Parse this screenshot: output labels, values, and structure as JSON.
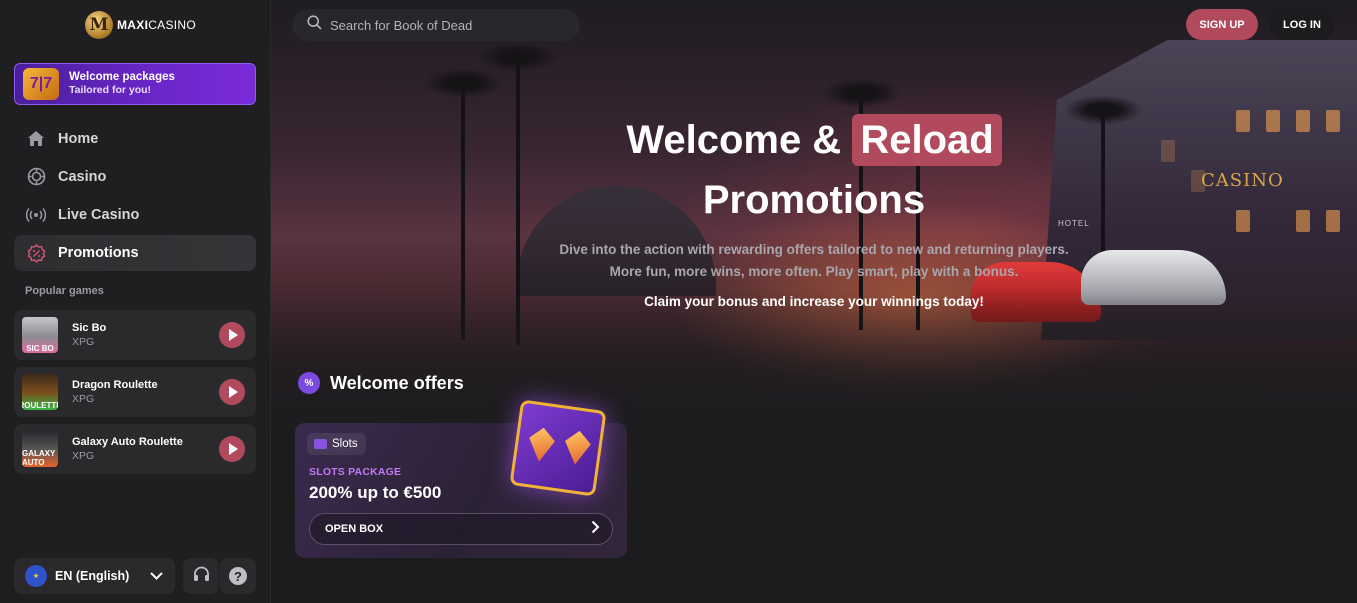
{
  "brand": {
    "logo_letter": "M",
    "name_bold": "MAXI",
    "name_light": "CASINO"
  },
  "welcome_pack": {
    "title": "Welcome packages",
    "subtitle": "Tailored for you!",
    "icon_text": "7|7"
  },
  "nav": {
    "items": [
      {
        "label": "Home",
        "icon": "home-icon"
      },
      {
        "label": "Casino",
        "icon": "casino-chip-icon"
      },
      {
        "label": "Live Casino",
        "icon": "live-broadcast-icon"
      },
      {
        "label": "Promotions",
        "icon": "promotions-percent-icon",
        "active": true
      }
    ]
  },
  "popular": {
    "title": "Popular games",
    "games": [
      {
        "name": "Sic Bo",
        "provider": "XPG",
        "thumb_text": "SIC BO"
      },
      {
        "name": "Dragon Roulette",
        "provider": "XPG",
        "thumb_text": "ROULETTE"
      },
      {
        "name": "Galaxy Auto Roulette",
        "provider": "XPG",
        "thumb_text": "GALAXY AUTO"
      }
    ]
  },
  "footer": {
    "language": "EN (English)"
  },
  "header": {
    "search_placeholder": "Search for Book of Dead",
    "signup_label": "SIGN UP",
    "login_label": "LOG IN"
  },
  "hero": {
    "title_part1": "Welcome &",
    "title_highlight": "Reload",
    "title_line2": "Promotions",
    "desc_line1": "Dive into the action with rewarding offers tailored to new and returning players.",
    "desc_line2": "More fun, more wins, more often. Play smart, play with a bonus.",
    "cta": "Claim your bonus and increase your winnings today!",
    "casino_sign": "CASINO",
    "hotel_sign": "HOTEL"
  },
  "offers": {
    "section_title": "Welcome offers",
    "section_icon_text": "%",
    "card": {
      "tag": "Slots",
      "label": "SLOTS PACKAGE",
      "amount": "200% up to €500",
      "button": "OPEN BOX"
    }
  },
  "colors": {
    "accent": "#b04a5c",
    "purple": "#7a4ae0",
    "bg": "#1c1c1e"
  }
}
